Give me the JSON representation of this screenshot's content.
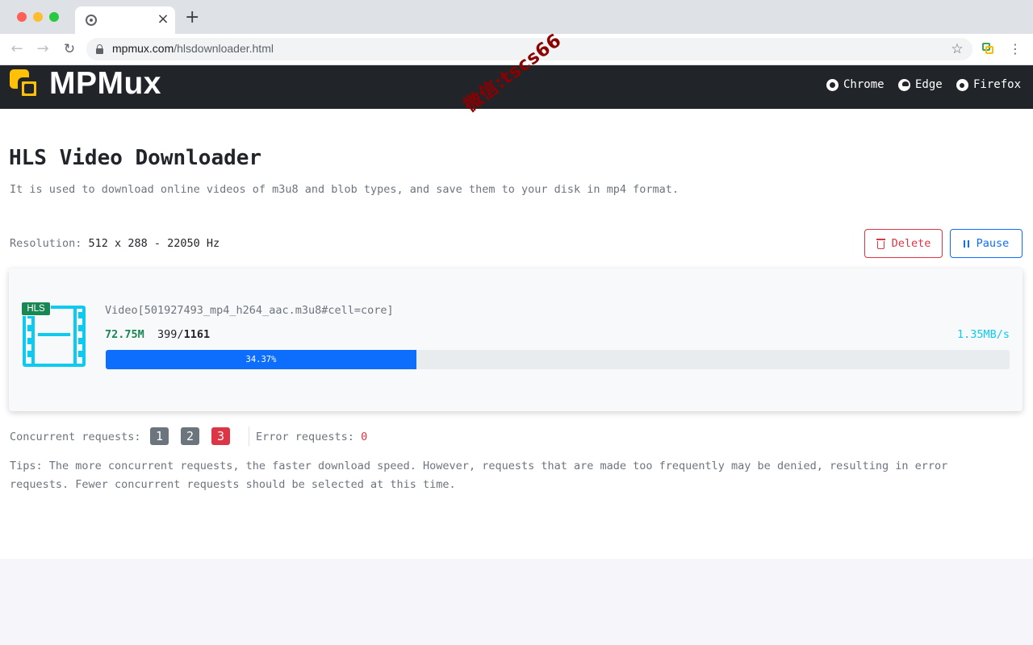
{
  "browser": {
    "tab_close": "×",
    "new_tab": "+",
    "url_host": "mpmux.com",
    "url_path": "/hlsdownloader.html",
    "nav": {
      "back": "←",
      "forward": "→",
      "reload": "↻"
    },
    "star": "☆",
    "menu": "⋮"
  },
  "site": {
    "logo": "MPMux",
    "links": [
      {
        "label": "Chrome",
        "icon": "chrome-icon"
      },
      {
        "label": "Edge",
        "icon": "edge-icon"
      },
      {
        "label": "Firefox",
        "icon": "firefox-icon"
      }
    ],
    "watermark": "微信:tscs66"
  },
  "main": {
    "title": "HLS Video Downloader",
    "subtitle": "It is used to download online videos of m3u8 and blob types, and save them to your disk in mp4 format.",
    "resolution_label": "Resolution:",
    "resolution_value": "512 x 288 - 22050 Hz",
    "delete_label": "Delete",
    "pause_label": "Pause"
  },
  "download": {
    "badge": "HLS",
    "name": "Video[501927493_mp4_h264_aac.m3u8#cell=core]",
    "size": "72.75M",
    "done": "399",
    "sep": "/",
    "total": "1161",
    "speed": "1.35MB/s",
    "progress_percent": 34.37,
    "progress_label": "34.37%"
  },
  "requests": {
    "concurrent_label": "Concurrent requests:",
    "options": [
      "1",
      "2",
      "3"
    ],
    "selected": "3",
    "error_label": "Error requests:",
    "error_value": "0",
    "tips": "Tips: The more concurrent requests, the faster download speed. However, requests that are made too frequently may be denied, resulting in error requests. Fewer concurrent requests should be selected at this time."
  },
  "colors": {
    "header_bg": "#212529",
    "accent": "#0d6efd",
    "danger": "#dc3545",
    "info": "#0dcaf0",
    "success": "#198754",
    "logo": "#ffc107"
  }
}
